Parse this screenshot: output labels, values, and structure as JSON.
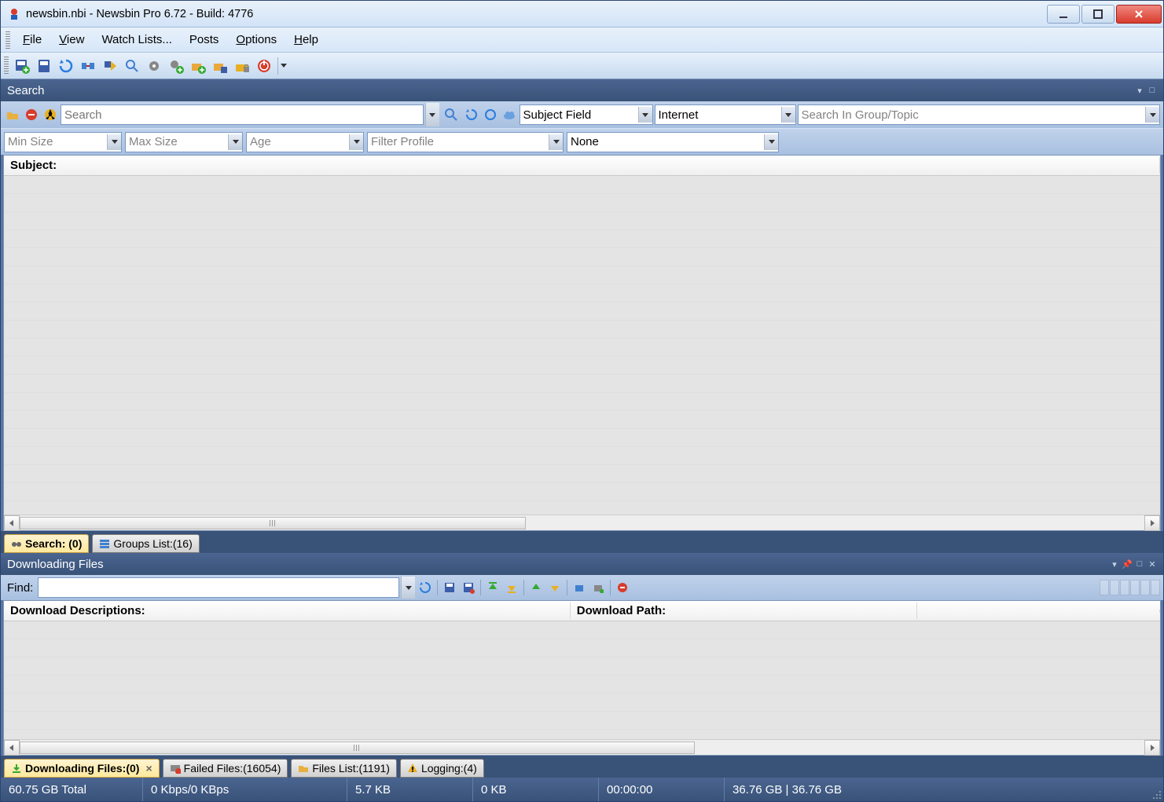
{
  "titlebar": {
    "text": "newsbin.nbi - Newsbin Pro 6.72 - Build: 4776"
  },
  "menu": {
    "items": [
      "File",
      "View",
      "Watch Lists...",
      "Posts",
      "Options",
      "Help"
    ]
  },
  "toolbar_icons": [
    "save-add-icon",
    "save-icon",
    "refresh-arrow-icon",
    "connection-icon",
    "traffic-icon",
    "zoom-icon",
    "gear-icon",
    "gear-add-icon",
    "load-add-icon",
    "load-save-icon",
    "folder-lock-icon",
    "power-icon"
  ],
  "panels": {
    "search": {
      "title": "Search"
    },
    "downloading": {
      "title": "Downloading Files"
    }
  },
  "search": {
    "input_placeholder": "Search",
    "scope_field": "Subject Field",
    "scope_source": "Internet",
    "group_placeholder": "Search In Group/Topic"
  },
  "filters": {
    "min_size": "Min Size",
    "max_size": "Max Size",
    "age": "Age",
    "filter_profile": "Filter Profile",
    "none": "None"
  },
  "search_grid": {
    "subject_header": "Subject:"
  },
  "search_tabs": {
    "search": "Search: (0)",
    "groups": "Groups List:(16)"
  },
  "find": {
    "label": "Find:"
  },
  "dl_grid": {
    "desc_header": "Download Descriptions:",
    "path_header": "Download Path:"
  },
  "bottom_tabs": {
    "downloading": "Downloading Files:(0)",
    "failed": "Failed Files:(16054)",
    "files": "Files List:(1191)",
    "logging": "Logging:(4)"
  },
  "status": {
    "total": "60.75 GB Total",
    "speed": "0 Kbps/0 KBps",
    "size_a": "5.7 KB",
    "size_b": "0 KB",
    "time": "00:00:00",
    "free": "36.76 GB | 36.76 GB"
  }
}
